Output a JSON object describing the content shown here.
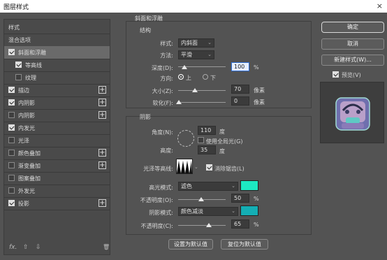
{
  "window": {
    "title": "图层样式",
    "close_icon": "×"
  },
  "sidebar": {
    "header_styles": "样式",
    "header_blend": "混合选项",
    "items": [
      {
        "label": "斜面和浮雕",
        "checked": true,
        "plus": false,
        "selected": true
      },
      {
        "label": "等高线",
        "checked": true,
        "plus": false,
        "sub": true
      },
      {
        "label": "纹理",
        "checked": false,
        "plus": false,
        "sub": true
      },
      {
        "label": "描边",
        "checked": true,
        "plus": true
      },
      {
        "label": "内阴影",
        "checked": true,
        "plus": true
      },
      {
        "label": "内阴影",
        "checked": false,
        "plus": true
      },
      {
        "label": "内发光",
        "checked": true,
        "plus": false
      },
      {
        "label": "光泽",
        "checked": false,
        "plus": false
      },
      {
        "label": "颜色叠加",
        "checked": false,
        "plus": true
      },
      {
        "label": "渐变叠加",
        "checked": false,
        "plus": true
      },
      {
        "label": "图案叠加",
        "checked": false,
        "plus": false
      },
      {
        "label": "外发光",
        "checked": false,
        "plus": false
      },
      {
        "label": "投影",
        "checked": true,
        "plus": true
      }
    ],
    "footer": {
      "fx": "fx.",
      "up": "⇧",
      "down": "⇩",
      "trash": "🗑"
    }
  },
  "bevel": {
    "section_title": "斜面和浮雕",
    "structure_title": "结构",
    "style_label": "样式:",
    "style_value": "内斜面",
    "technique_label": "方法:",
    "technique_value": "平滑",
    "depth_label": "深度(D):",
    "depth_value": "100",
    "depth_unit": "%",
    "direction_label": "方向:",
    "dir_up": "上",
    "dir_down": "下",
    "size_label": "大小(Z):",
    "size_value": "70",
    "size_unit": "像素",
    "soften_label": "软化(F):",
    "soften_value": "0",
    "soften_unit": "像素"
  },
  "shading": {
    "title": "阴影",
    "angle_label": "角度(N):",
    "angle_value": "110",
    "angle_unit": "度",
    "global_light_label": "使用全局光(G)",
    "altitude_label": "高度:",
    "altitude_value": "35",
    "altitude_unit": "度",
    "gloss_label": "光泽等高线:",
    "anti_alias_label": "消除锯齿(L)",
    "highlight_mode_label": "高光模式:",
    "highlight_mode_value": "滤色",
    "highlight_color": "#1de8c2",
    "highlight_opacity_label": "不透明度(O):",
    "highlight_opacity_value": "50",
    "highlight_opacity_unit": "%",
    "shadow_mode_label": "阴影模式:",
    "shadow_mode_value": "颜色减淡",
    "shadow_color": "#14aeb4",
    "shadow_opacity_label": "不透明度(C):",
    "shadow_opacity_value": "65",
    "shadow_opacity_unit": "%"
  },
  "bottom": {
    "set_default": "设置为默认值",
    "reset_default": "复位为默认值"
  },
  "right": {
    "ok": "确定",
    "cancel": "取消",
    "new_style": "新建样式(W)...",
    "preview_label": "预览(V)"
  }
}
